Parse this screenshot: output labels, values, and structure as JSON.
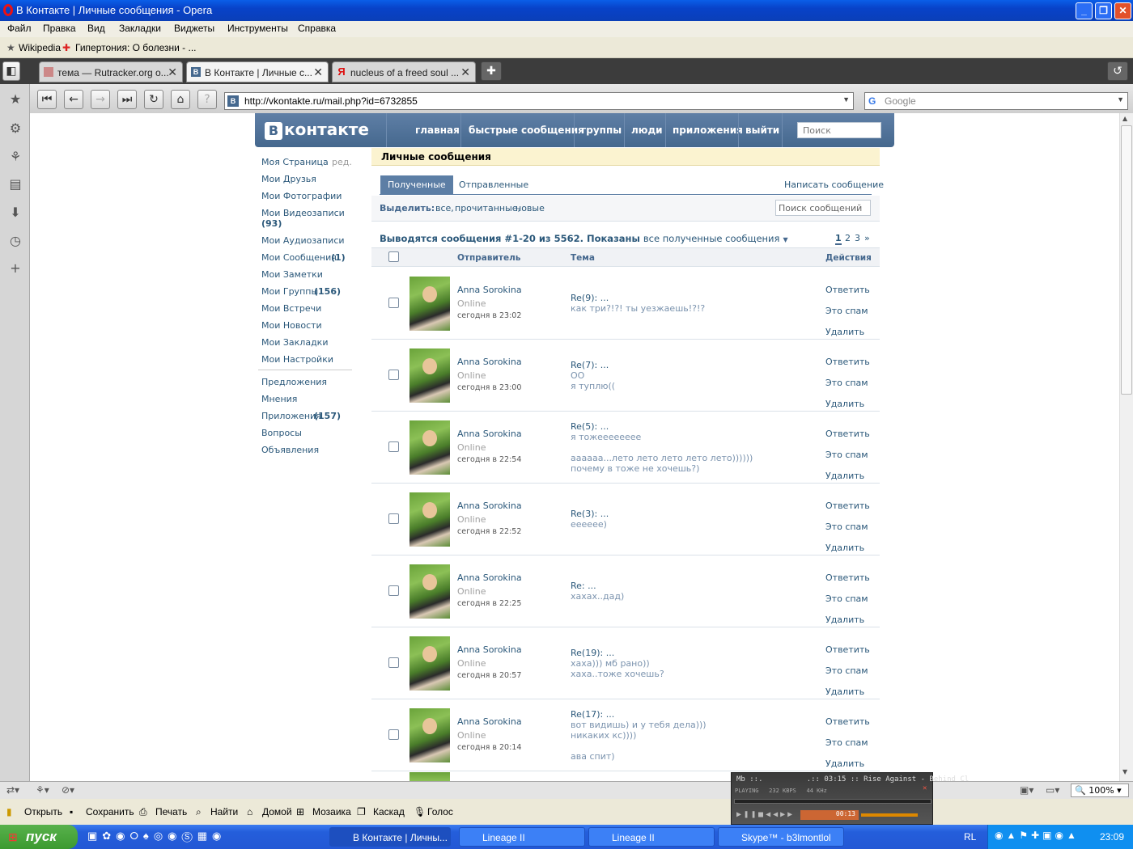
{
  "window": {
    "title": "В Контакте | Личные сообщения - Opera"
  },
  "menu": [
    "Файл",
    "Правка",
    "Вид",
    "Закладки",
    "Виджеты",
    "Инструменты",
    "Справка"
  ],
  "bookmarks": [
    "Wikipedia",
    "Гипертония: О болезни - ..."
  ],
  "tabs": [
    {
      "label": "тема — Rutracker.org о..."
    },
    {
      "label": "В Контакте | Личные с..."
    },
    {
      "label": "nucleus of a freed soul ..."
    }
  ],
  "address": {
    "url": "http://vkontakte.ru/mail.php?id=6732855",
    "search_placeholder": "Google"
  },
  "vk": {
    "logo": "контакте",
    "logo_b": "В",
    "nav": [
      "главная",
      "быстрые сообщения",
      "группы",
      "люди",
      "приложения",
      "выйти"
    ],
    "search_placeholder": "Поиск"
  },
  "sidebar": {
    "my_page": "Моя Страница",
    "edit": "ред.",
    "friends": "Мои Друзья",
    "photos": "Мои Фотографии",
    "videos": "Мои Видеозаписи",
    "videos_count": "(93)",
    "audio": "Мои Аудиозаписи",
    "messages": "Мои Сообщения",
    "messages_count": "(1)",
    "notes": "Мои Заметки",
    "groups": "Мои Группы",
    "groups_count": "(156)",
    "meetings": "Мои Встречи",
    "news": "Мои Новости",
    "bookmarks": "Мои Закладки",
    "settings": "Мои Настройки",
    "offers": "Предложения",
    "opinions": "Мнения",
    "apps": "Приложения",
    "apps_count": "(157)",
    "questions": "Вопросы",
    "ads": "Объявления"
  },
  "mail": {
    "header": "Личные сообщения",
    "tab_received": "Полученные",
    "tab_sent": "Отправленные",
    "write": "Написать сообщение",
    "select_label": "Выделить:",
    "select_all": "все,",
    "select_read": "прочитанные,",
    "select_new": "новые",
    "search_placeholder": "Поиск сообщений",
    "count_text": "Выводятся сообщения #1-20 из 5562. Показаны",
    "count_filter": "все полученные сообщения",
    "pages": [
      "1",
      "2",
      "3",
      "»"
    ],
    "col_sender": "Отправитель",
    "col_subject": "Тема",
    "col_actions": "Действия",
    "act_reply": "Ответить",
    "act_spam": "Это спам",
    "act_delete": "Удалить",
    "messages": [
      {
        "sender": "Anna Sorokina",
        "status": "Online",
        "date": "сегодня в 23:02",
        "subject": "Re(9): ...",
        "lines": [
          "как три?!?! ты уезжаешь!?!?"
        ]
      },
      {
        "sender": "Anna Sorokina",
        "status": "Online",
        "date": "сегодня в 23:00",
        "subject": "Re(7): ...",
        "lines": [
          "ОО",
          "я туплю(("
        ]
      },
      {
        "sender": "Anna Sorokina",
        "status": "Online",
        "date": "сегодня в 22:54",
        "subject": "Re(5): ...",
        "lines": [
          "я тожееееееее",
          "",
          "аааааа...лето лето лето лето лето))))))",
          "почему в тоже не хочешь?)"
        ]
      },
      {
        "sender": "Anna Sorokina",
        "status": "Online",
        "date": "сегодня в 22:52",
        "subject": "Re(3): ...",
        "lines": [
          "ееееее)"
        ]
      },
      {
        "sender": "Anna Sorokina",
        "status": "Online",
        "date": "сегодня в 22:25",
        "subject": "Re: ...",
        "lines": [
          "хахах..дад)"
        ]
      },
      {
        "sender": "Anna Sorokina",
        "status": "Online",
        "date": "сегодня в 20:57",
        "subject": "Re(19): ...",
        "lines": [
          "хаха))) мб рано))",
          "хаха..тоже хочешь?"
        ]
      },
      {
        "sender": "Anna Sorokina",
        "status": "Online",
        "date": "сегодня в 20:14",
        "subject": "Re(17): ...",
        "lines": [
          "вот видишь) и у тебя дела)))",
          "никаких кс))))",
          "",
          "ава спит)"
        ]
      }
    ]
  },
  "zoom": "100%",
  "bottom_toolbar": [
    "Открыть",
    "Сохранить",
    "Печать",
    "Найти",
    "Домой",
    "Мозаика",
    "Каскад",
    "Голос"
  ],
  "player": {
    "line1": "Mb ::.          .:: 03:15 :: Rise Against - Behind Cl",
    "line2": "PLAYING   232 KBPS   44 KHz",
    "time": "00:13"
  },
  "taskbar": {
    "start": "пуск",
    "tasks": [
      "В Контакте | Личны...",
      "Lineage II",
      "Lineage II",
      "Skype™ - b3lmontlol"
    ],
    "lang": "RL",
    "clock": "23:09"
  },
  "colors": {
    "vk_blue": "#45688e",
    "link": "#2b587a",
    "header_yellow": "#fbf3d0"
  }
}
